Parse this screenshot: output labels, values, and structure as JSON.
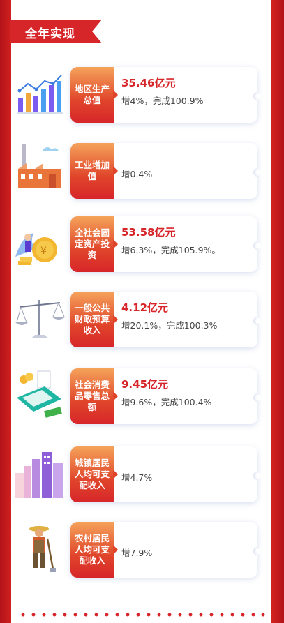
{
  "section_title": "全年实现",
  "items": [
    {
      "label": "地区生产总值",
      "value": "35.46亿元",
      "detail": "增4%，完成100.9%",
      "icon": "bar-chart-growth-icon"
    },
    {
      "label": "工业增加值",
      "value": "",
      "detail": "增0.4%",
      "icon": "factory-icon"
    },
    {
      "label": "全社会固定资产投资",
      "value": "53.58亿元",
      "detail": "增6.3%，完成105.9%。",
      "icon": "investment-coin-icon"
    },
    {
      "label": "一般公共财政预算收入",
      "value": "4.12亿元",
      "detail": "增20.1%，完成100.3%",
      "icon": "balance-scale-icon"
    },
    {
      "label": "社会消费品零售总额",
      "value": "9.45亿元",
      "detail": "增9.6%，完成100.4%",
      "icon": "pos-terminal-icon"
    },
    {
      "label": "城镇居民人均可支配收入",
      "value": "",
      "detail": "增4.7%",
      "icon": "city-buildings-icon"
    },
    {
      "label": "农村居民人均可支配收入",
      "value": "",
      "detail": "增7.9%",
      "icon": "farmer-icon"
    }
  ],
  "colors": {
    "primary_red": "#d7262a",
    "label_gradient_top": "#f5a35a",
    "text_gray": "#444444"
  }
}
